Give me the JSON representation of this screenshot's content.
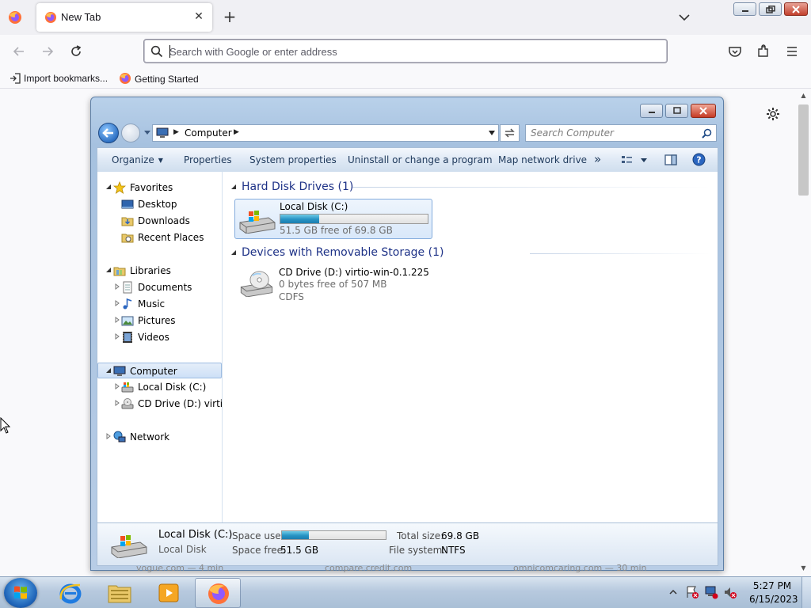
{
  "browser": {
    "tab_title": "New Tab",
    "address_placeholder": "Search with Google or enter address",
    "bookmarks": [
      "Import bookmarks...",
      "Getting Started"
    ]
  },
  "explorer": {
    "breadcrumb": "Computer",
    "search_placeholder": "Search Computer",
    "toolbar": {
      "organize": "Organize",
      "properties": "Properties",
      "system_properties": "System properties",
      "uninstall": "Uninstall or change a program",
      "map_drive": "Map network drive",
      "more": "»"
    },
    "nav": {
      "favorites": "Favorites",
      "desktop": "Desktop",
      "downloads": "Downloads",
      "recent": "Recent Places",
      "libraries": "Libraries",
      "documents": "Documents",
      "music": "Music",
      "pictures": "Pictures",
      "videos": "Videos",
      "computer": "Computer",
      "local_disk": "Local Disk (C:)",
      "cd_drive": "CD Drive (D:) virtio-w",
      "network": "Network"
    },
    "groups": {
      "hdd": "Hard Disk Drives (1)",
      "removable": "Devices with Removable Storage (1)"
    },
    "drive_c": {
      "name": "Local Disk (C:)",
      "free_text": "51.5 GB free of 69.8 GB",
      "used_fraction": 0.262
    },
    "drive_d": {
      "name": "CD Drive (D:) virtio-win-0.1.225",
      "free_text": "0 bytes free of 507 MB",
      "filesystem": "CDFS"
    },
    "details": {
      "name": "Local Disk (C:)",
      "type": "Local Disk",
      "space_used_label": "Space used:",
      "space_free_label": "Space free:",
      "space_free_value": "51.5 GB",
      "total_label": "Total size:",
      "total_value": "69.8 GB",
      "fs_label": "File system:",
      "fs_value": "NTFS",
      "used_fraction": 0.262
    }
  },
  "background_strip": {
    "items": [
      "vogue.com — 4 min",
      "compare.credit.com",
      "omnicomcaring.com — 30 min"
    ]
  },
  "taskbar": {
    "time": "5:27 PM",
    "date": "6/15/2023"
  },
  "colors": {
    "accent": "#2693c4",
    "explorer_frame": "#a6c1df",
    "link_blue": "#1e3287"
  }
}
